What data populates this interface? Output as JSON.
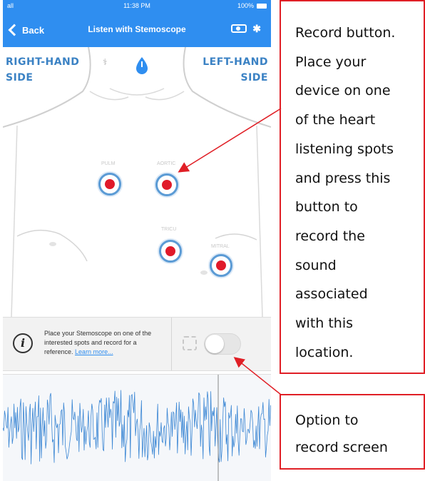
{
  "status_bar": {
    "signal": "all",
    "time": "11:38 PM",
    "battery": "100%"
  },
  "nav": {
    "back_label": "Back",
    "title": "Listen with Stemoscope"
  },
  "body": {
    "right_side_label_1": "RIGHT-HAND",
    "right_side_label_2": "SIDE",
    "left_side_label_1": "LEFT-HAND",
    "left_side_label_2": "SIDE",
    "spots": [
      {
        "label": "PULM"
      },
      {
        "label": "AORTIC"
      },
      {
        "label": "TRICU"
      },
      {
        "label": "MITRAL"
      }
    ]
  },
  "info": {
    "text": "Place your Stemoscope on one of the interested spots and record for a reference.",
    "link": "Learn more..."
  },
  "callouts": {
    "record_button": [
      "Record button.",
      "Place your",
      "device on one",
      "of the heart",
      "listening spots",
      "and press this",
      "button to",
      "record the",
      "sound",
      "associated",
      "with this",
      "location."
    ],
    "record_screen": [
      "Option to",
      "record screen"
    ]
  },
  "colors": {
    "nav_blue": "#2f8ef0",
    "spot_red": "#e01a2a",
    "spot_ring": "#5b9bd5",
    "callout_red": "#e01f26",
    "waveform": "#3a86d4"
  },
  "icons": {
    "back": "chevron-left-icon",
    "camera": "camera-icon",
    "bluetooth": "bluetooth-icon",
    "info": "info-icon",
    "mic": "stethoscope-drop-icon"
  }
}
